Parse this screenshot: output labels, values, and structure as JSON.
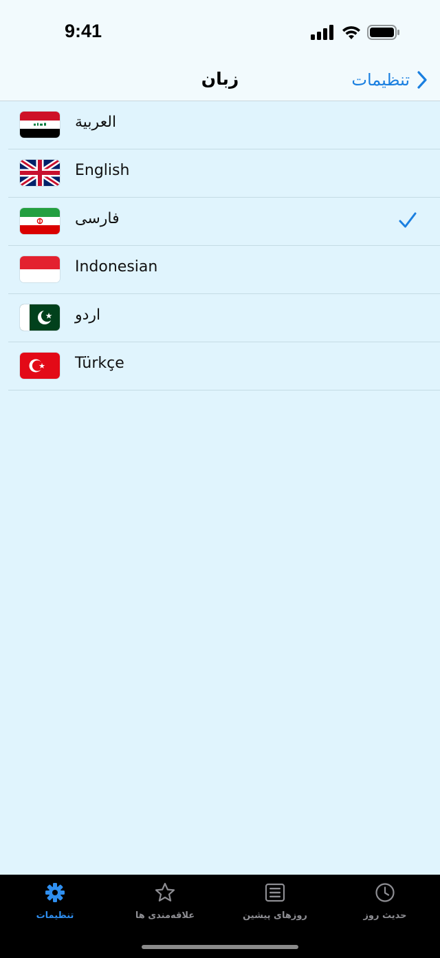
{
  "status_bar": {
    "time": "9:41"
  },
  "nav": {
    "title": "زبان",
    "back_label": "تنظیمات"
  },
  "languages": [
    {
      "label": "العربية",
      "flag": "iraq-flag-icon",
      "selected": false
    },
    {
      "label": "English",
      "flag": "uk-flag-icon",
      "selected": false
    },
    {
      "label": "فارسی",
      "flag": "iran-flag-icon",
      "selected": true
    },
    {
      "label": "Indonesian",
      "flag": "indonesia-flag-icon",
      "selected": false
    },
    {
      "label": "اردو",
      "flag": "pakistan-flag-icon",
      "selected": false
    },
    {
      "label": "Türkçe",
      "flag": "turkey-flag-icon",
      "selected": false
    }
  ],
  "tabs": [
    {
      "label": "تنظیمات",
      "icon": "gear-icon",
      "active": true
    },
    {
      "label": "علاقه‌مندی ها",
      "icon": "star-icon",
      "active": false
    },
    {
      "label": "روزهای پیشین",
      "icon": "list-icon",
      "active": false
    },
    {
      "label": "حدیث روز",
      "icon": "clock-icon",
      "active": false
    }
  ],
  "colors": {
    "accent": "#1a7fe0",
    "background": "#e0f4fd",
    "tab_active": "#2f8ff0",
    "tab_inactive": "#8e8e93"
  }
}
